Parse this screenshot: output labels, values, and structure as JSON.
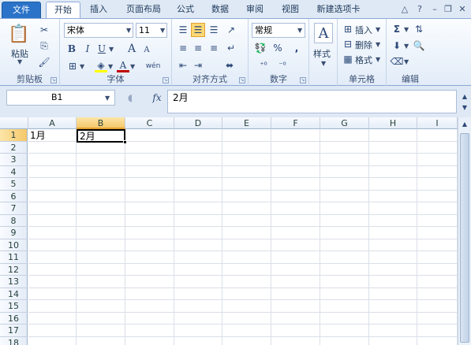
{
  "tabs": {
    "file": "文件",
    "items": [
      "开始",
      "插入",
      "页面布局",
      "公式",
      "数据",
      "审阅",
      "视图",
      "新建选项卡"
    ]
  },
  "window_controls": {
    "help": "help-icon",
    "minimize": "minimize-icon",
    "restore": "restore-icon",
    "close": "close-icon"
  },
  "ribbon": {
    "clipboard": {
      "label": "剪贴板",
      "paste": "粘贴"
    },
    "font": {
      "label": "字体",
      "font_name": "宋体",
      "font_size": "11",
      "bold": "B",
      "italic": "I",
      "underline": "U",
      "grow": "A",
      "shrink": "A",
      "font_color": "A",
      "phonetic": "wén",
      "fill_color_hex": "#ffff00",
      "font_color_hex": "#c00000"
    },
    "alignment": {
      "label": "对齐方式"
    },
    "number": {
      "label": "数字",
      "format": "常规",
      "percent": "%",
      "comma": ","
    },
    "styles": {
      "label": "样式"
    },
    "cells": {
      "label": "单元格",
      "insert": "插入",
      "delete": "删除",
      "format": "格式"
    },
    "editing": {
      "label": "编辑",
      "sum": "Σ"
    }
  },
  "formula_bar": {
    "name_box": "B1",
    "fx": "fx",
    "content": "2月"
  },
  "sheet": {
    "columns": [
      "A",
      "B",
      "C",
      "D",
      "E",
      "F",
      "G",
      "H",
      "I"
    ],
    "rows": [
      "1",
      "2",
      "3",
      "4",
      "5",
      "6",
      "7",
      "8",
      "9",
      "10",
      "11",
      "12",
      "13",
      "14",
      "15",
      "16",
      "17",
      "18"
    ],
    "selected_cell": "B1",
    "cells": {
      "A1": "1月",
      "B1": "2月"
    }
  },
  "accent_colors": {
    "file_tab": "#2a73c8",
    "selection": "#f5c86a",
    "border": "#8eaad8"
  }
}
